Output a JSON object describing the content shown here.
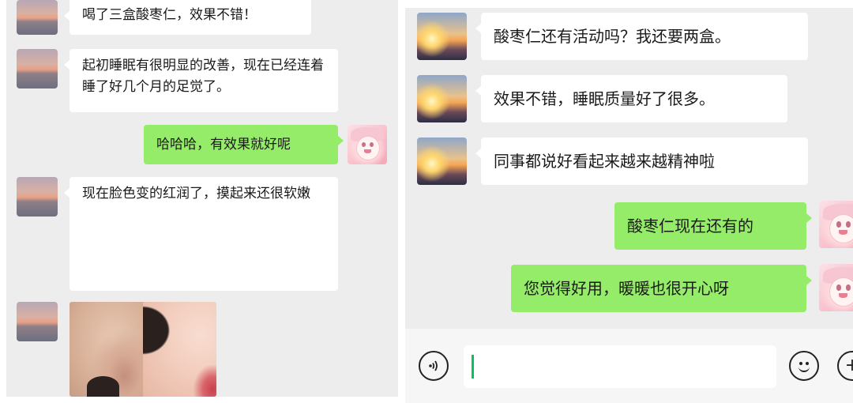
{
  "left_chat": {
    "messages": [
      {
        "side": "left",
        "text": "喝了三盒酸枣仁，效果不错！"
      },
      {
        "side": "left",
        "text": "起初睡眠有很明显的改善，现在已经连着睡了好几个月的足觉了。"
      },
      {
        "side": "right",
        "text": "哈哈哈，有效果就好呢"
      },
      {
        "side": "left",
        "text": "现在脸色变的红润了，摸起来还很软嫩"
      }
    ]
  },
  "right_chat": {
    "messages": [
      {
        "side": "left",
        "text": "酸枣仁还有活动吗？我还要两盒。"
      },
      {
        "side": "left",
        "text": "效果不错，睡眠质量好了很多。"
      },
      {
        "side": "left",
        "text": "同事都说好看起来越来越精神啦"
      },
      {
        "side": "right",
        "text": "酸枣仁现在还有的"
      },
      {
        "side": "right",
        "text": "您觉得好用，暖暖也很开心呀"
      }
    ],
    "input_bar": {
      "voice_icon": "voice-icon",
      "emoji_icon": "emoji-icon",
      "plus_icon": "plus-icon",
      "input_value": ""
    }
  },
  "colors": {
    "chat_background": "#ededed",
    "sent_bubble": "#95ec69",
    "received_bubble": "#ffffff",
    "caret": "#07c160"
  }
}
